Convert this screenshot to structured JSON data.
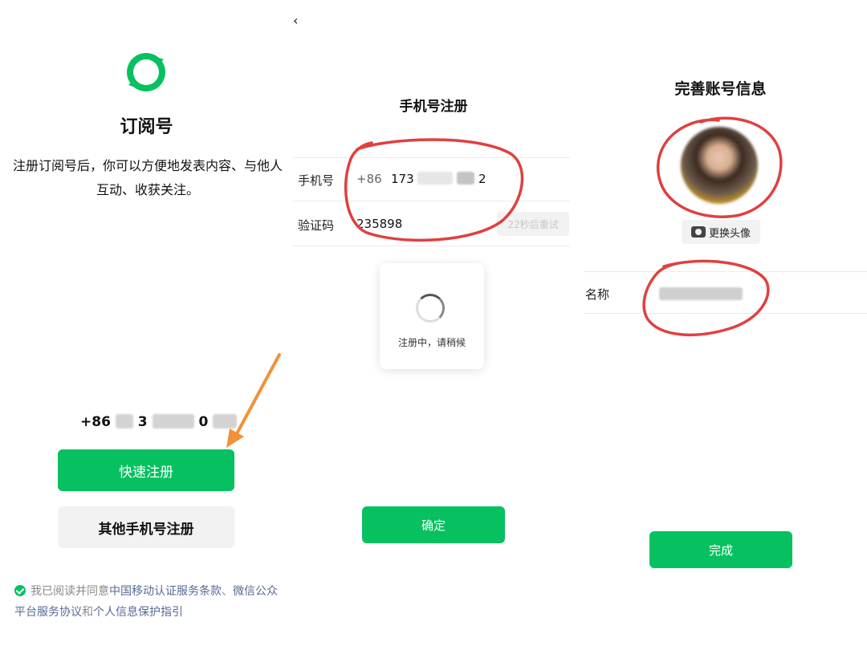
{
  "panel1": {
    "title": "订阅号",
    "description": "注册订阅号后，你可以方便地发表内容、与他人互动、收获关注。",
    "phone_prefix": "+86",
    "phone_mid": "3",
    "phone_end": "0",
    "quick_register": "快速注册",
    "other_register": "其他手机号注册",
    "agreement": {
      "prefix": "我已阅读并同意",
      "link1": "中国移动认证服务条款",
      "sep1": "、",
      "link2": "微信公众平台服务协议",
      "and": "和",
      "link3": "个人信息保护指引"
    }
  },
  "panel2": {
    "back_glyph": "‹",
    "title": "手机号注册",
    "phone_label": "手机号",
    "country_code": "+86",
    "phone_visible_start": "173",
    "phone_visible_end": "2",
    "code_label": "验证码",
    "code_value": "235898",
    "resend": "22秒后重试",
    "toast": "注册中，请稍候",
    "confirm": "确定"
  },
  "panel3": {
    "title": "完善账号信息",
    "change_avatar": "更换头像",
    "name_label": "名称",
    "finish": "完成"
  },
  "colors": {
    "primary_green": "#07c160",
    "link_blue": "#576b95",
    "annotation_red": "#e04040",
    "arrow_orange": "#f0923a"
  }
}
